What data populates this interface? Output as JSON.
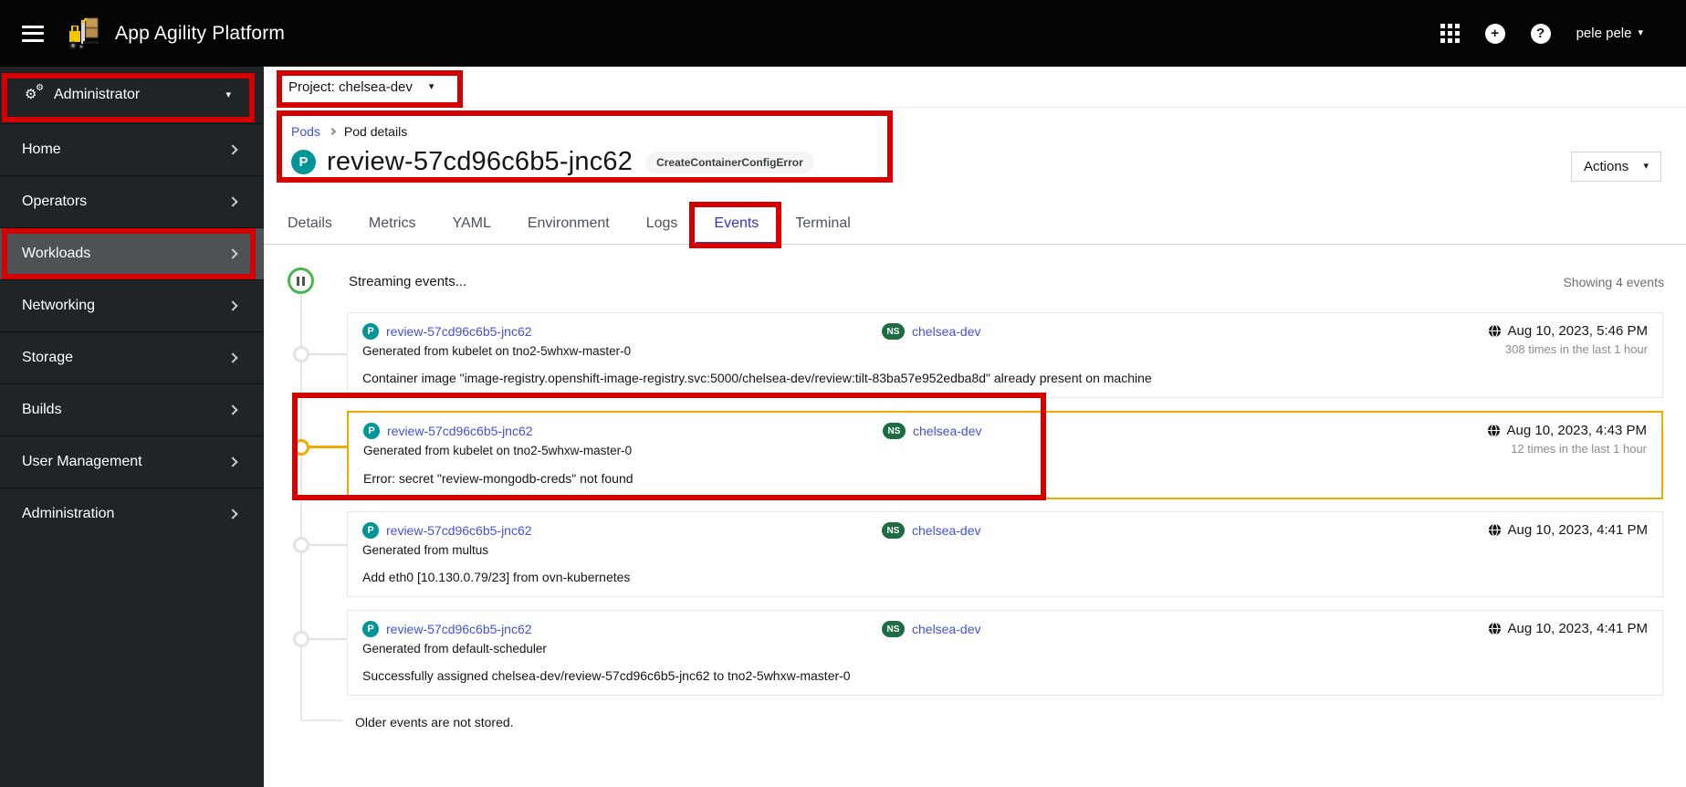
{
  "topbar": {
    "title": "App Agility Platform",
    "user": "pele pele"
  },
  "sidebar": {
    "perspective": "Administrator",
    "items": [
      {
        "label": "Home",
        "active": false
      },
      {
        "label": "Operators",
        "active": false
      },
      {
        "label": "Workloads",
        "active": true
      },
      {
        "label": "Networking",
        "active": false
      },
      {
        "label": "Storage",
        "active": false
      },
      {
        "label": "Builds",
        "active": false
      },
      {
        "label": "User Management",
        "active": false
      },
      {
        "label": "Administration",
        "active": false
      }
    ]
  },
  "project_bar": {
    "label": "Project: chelsea-dev"
  },
  "page": {
    "breadcrumb": {
      "link": "Pods",
      "current": "Pod details"
    },
    "resource_abbr": "P",
    "title": "review-57cd96c6b5-jnc62",
    "status_badge": "CreateContainerConfigError",
    "actions_label": "Actions"
  },
  "tabs": {
    "items": [
      {
        "label": "Details",
        "active": false
      },
      {
        "label": "Metrics",
        "active": false
      },
      {
        "label": "YAML",
        "active": false
      },
      {
        "label": "Environment",
        "active": false
      },
      {
        "label": "Logs",
        "active": false
      },
      {
        "label": "Events",
        "active": true
      },
      {
        "label": "Terminal",
        "active": false
      }
    ]
  },
  "events": {
    "streaming": "Streaming events...",
    "showing": "Showing 4 events",
    "older": "Older events are not stored.",
    "pod_abbr": "P",
    "namespace_abbr": "NS",
    "rows": [
      {
        "resource": "review-57cd96c6b5-jnc62",
        "source": "Generated from kubelet on tno2-5whxw-master-0",
        "namespace": "chelsea-dev",
        "timestamp": "Aug 10, 2023, 5:46 PM",
        "count": "308 times in the last 1 hour",
        "message": "Container image \"image-registry.openshift-image-registry.svc:5000/chelsea-dev/review:tilt-83ba57e952edba8d\" already present on machine",
        "highlight": false
      },
      {
        "resource": "review-57cd96c6b5-jnc62",
        "source": "Generated from kubelet on tno2-5whxw-master-0",
        "namespace": "chelsea-dev",
        "timestamp": "Aug 10, 2023, 4:43 PM",
        "count": "12 times in the last 1 hour",
        "message": "Error: secret \"review-mongodb-creds\" not found",
        "highlight": true
      },
      {
        "resource": "review-57cd96c6b5-jnc62",
        "source": "Generated from multus",
        "namespace": "chelsea-dev",
        "timestamp": "Aug 10, 2023, 4:41 PM",
        "count": "",
        "message": "Add eth0 [10.130.0.79/23] from ovn-kubernetes",
        "highlight": false
      },
      {
        "resource": "review-57cd96c6b5-jnc62",
        "source": "Generated from default-scheduler",
        "namespace": "chelsea-dev",
        "timestamp": "Aug 10, 2023, 4:41 PM",
        "count": "",
        "message": "Successfully assigned chelsea-dev/review-57cd96c6b5-jnc62 to tno2-5whxw-master-0",
        "highlight": false
      }
    ]
  },
  "colors": {
    "annotation_red": "#d40000",
    "warning_gold": "#f0ab00",
    "pod_teal": "#009596",
    "namespace_green": "#1d6c43",
    "link_blue": "#4450d6",
    "streaming_green": "#4ab54e"
  }
}
